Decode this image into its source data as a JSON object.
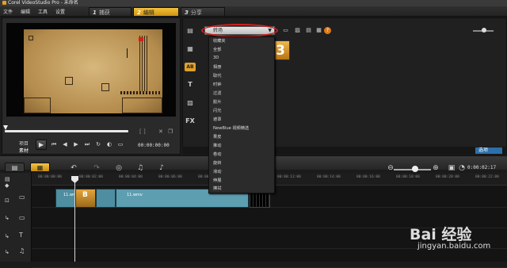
{
  "window": {
    "title": "Corel VideoStudio Pro - 未命名"
  },
  "menu": [
    "文件",
    "编辑",
    "工具",
    "设置"
  ],
  "steps": [
    {
      "num": "1",
      "label": "捕获"
    },
    {
      "num": "2",
      "label": "编辑"
    },
    {
      "num": "3",
      "label": "分享"
    }
  ],
  "player": {
    "mode_project": "项目",
    "mode_clip": "素材",
    "timecode": "00:00:00:00",
    "progress_fraction": 0.0
  },
  "library": {
    "dropdown_selected": "转场",
    "dropdown_options": [
      "收藏夹",
      "全部",
      "3D",
      "相册",
      "取代",
      "时钟",
      "过滤",
      "胶片",
      "闪光",
      "遮罩",
      "NewBlue 视频精选",
      "果皮",
      "推动",
      "卷动",
      "旋转",
      "滑动",
      "伸展",
      "擦拭"
    ],
    "options_button": "选项",
    "thumb_glyph": "3"
  },
  "side_icons": [
    "media-icon",
    "instant-project-icon",
    "transition-icon",
    "title-icon",
    "graphic-icon",
    "fx-icon"
  ],
  "side_icon_glyphs": [
    "▤",
    "▦",
    "AB",
    "T",
    "▨",
    "FX"
  ],
  "timeline": {
    "timecode": "0:00:02:17",
    "ruler_labels": [
      "00:00:00:00",
      "00:00:02:00",
      "00:00:04:00",
      "00:00:06:00",
      "00:00:08:00",
      "00:00:10:00",
      "00:00:12:00",
      "00:00:14:00",
      "00:00:16:00",
      "00:00:18:00",
      "00:00:20:00",
      "00:00:22:00"
    ],
    "clips": [
      {
        "label": "11.wm"
      },
      {
        "label": "B"
      },
      {
        "label": "11.wmv"
      }
    ]
  },
  "watermark": {
    "logo": "Bai 经验",
    "url": "jingyan.baidu.com"
  }
}
